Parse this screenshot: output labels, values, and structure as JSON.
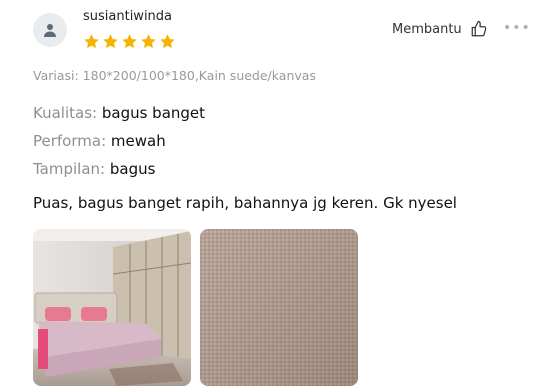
{
  "review": {
    "username": "susiantiwinda",
    "rating": 5,
    "helpful_label": "Membantu",
    "more_label": "•••",
    "variant": "Variasi: 180*200/100*180,Kain suede/kanvas",
    "attributes": [
      {
        "key": "Kualitas:",
        "value": "bagus banget"
      },
      {
        "key": "Performa:",
        "value": "mewah"
      },
      {
        "key": "Tampilan:",
        "value": "bagus"
      }
    ],
    "comment": "Puas, bagus banget rapih, bahannya jg keren. Gk nyesel"
  },
  "icons": {
    "avatar": "user-icon",
    "star": "star-icon",
    "helpful": "thumbs-up-icon",
    "more": "more-dots-icon"
  },
  "colors": {
    "star": "#f5b301",
    "muted": "#9a9a9a"
  },
  "photos": [
    {
      "name": "bedroom-photo"
    },
    {
      "name": "fabric-photo"
    }
  ]
}
